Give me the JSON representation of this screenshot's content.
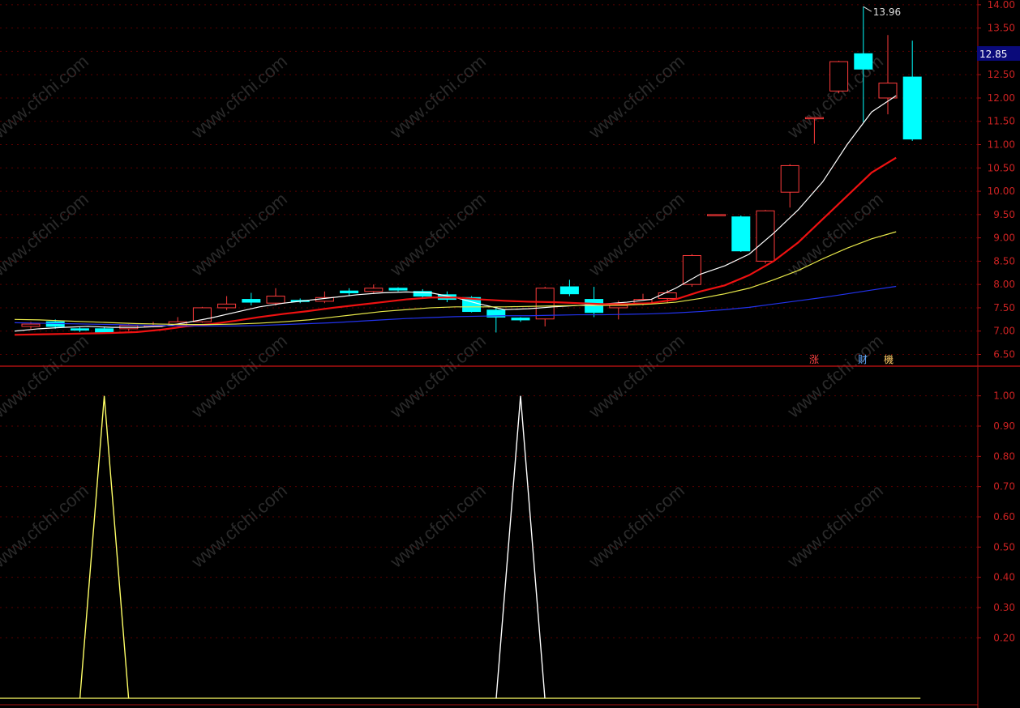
{
  "chart_data": [
    {
      "type": "candlestick",
      "price_axis": {
        "ylim": [
          6.3,
          14.05
        ],
        "ticks": [
          14.0,
          13.5,
          13.0,
          12.5,
          12.0,
          11.5,
          11.0,
          10.5,
          10.0,
          9.5,
          9.0,
          8.5,
          8.0,
          7.5,
          7.0,
          6.5
        ]
      },
      "last_price": "12.85",
      "max_label": "13.96",
      "candles": [
        {
          "o": 7.1,
          "c": 7.15,
          "h": 7.2,
          "l": 7.05
        },
        {
          "o": 7.2,
          "c": 7.1,
          "h": 7.25,
          "l": 7.05
        },
        {
          "o": 7.05,
          "c": 7.02,
          "h": 7.08,
          "l": 6.98
        },
        {
          "o": 7.05,
          "c": 6.98,
          "h": 7.08,
          "l": 6.95
        },
        {
          "o": 7.05,
          "c": 7.12,
          "h": 7.15,
          "l": 7.0
        },
        {
          "o": 7.1,
          "c": 7.12,
          "h": 7.2,
          "l": 7.08
        },
        {
          "o": 7.12,
          "c": 7.2,
          "h": 7.3,
          "l": 7.1
        },
        {
          "o": 7.2,
          "c": 7.5,
          "h": 7.52,
          "l": 7.18
        },
        {
          "o": 7.5,
          "c": 7.58,
          "h": 7.75,
          "l": 7.45
        },
        {
          "o": 7.68,
          "c": 7.62,
          "h": 7.82,
          "l": 7.55
        },
        {
          "o": 7.6,
          "c": 7.75,
          "h": 7.92,
          "l": 7.55
        },
        {
          "o": 7.66,
          "c": 7.64,
          "h": 7.7,
          "l": 7.6
        },
        {
          "o": 7.64,
          "c": 7.72,
          "h": 7.85,
          "l": 7.6
        },
        {
          "o": 7.86,
          "c": 7.82,
          "h": 7.92,
          "l": 7.75
        },
        {
          "o": 7.85,
          "c": 7.92,
          "h": 8.0,
          "l": 7.8
        },
        {
          "o": 7.92,
          "c": 7.88,
          "h": 7.94,
          "l": 7.85
        },
        {
          "o": 7.85,
          "c": 7.75,
          "h": 7.9,
          "l": 7.72
        },
        {
          "o": 7.78,
          "c": 7.68,
          "h": 7.85,
          "l": 7.62
        },
        {
          "o": 7.72,
          "c": 7.42,
          "h": 7.75,
          "l": 7.4
        },
        {
          "o": 7.45,
          "c": 7.3,
          "h": 7.52,
          "l": 6.97
        },
        {
          "o": 7.28,
          "c": 7.24,
          "h": 7.3,
          "l": 7.2
        },
        {
          "o": 7.26,
          "c": 7.92,
          "h": 7.95,
          "l": 7.1
        },
        {
          "o": 7.95,
          "c": 7.8,
          "h": 8.1,
          "l": 7.75
        },
        {
          "o": 7.68,
          "c": 7.4,
          "h": 7.95,
          "l": 7.3
        },
        {
          "o": 7.5,
          "c": 7.55,
          "h": 7.65,
          "l": 7.25
        },
        {
          "o": 7.6,
          "c": 7.68,
          "h": 7.8,
          "l": 7.55
        },
        {
          "o": 7.7,
          "c": 7.82,
          "h": 7.88,
          "l": 7.6
        },
        {
          "o": 8.0,
          "c": 8.62,
          "h": 8.65,
          "l": 7.95
        },
        {
          "o": 9.5,
          "c": 9.5,
          "h": 9.5,
          "l": 9.5
        },
        {
          "o": 9.45,
          "c": 8.72,
          "h": 9.48,
          "l": 8.7
        },
        {
          "o": 8.5,
          "c": 9.58,
          "h": 9.6,
          "l": 8.45
        },
        {
          "o": 9.98,
          "c": 10.55,
          "h": 10.58,
          "l": 9.65
        },
        {
          "o": 11.58,
          "c": 11.58,
          "h": 11.58,
          "l": 11.02
        },
        {
          "o": 12.15,
          "c": 12.78,
          "h": 12.8,
          "l": 12.1
        },
        {
          "o": 12.95,
          "c": 12.62,
          "h": 13.96,
          "l": 11.48
        },
        {
          "o": 12.0,
          "c": 12.32,
          "h": 13.35,
          "l": 11.65
        },
        {
          "o": 12.45,
          "c": 11.12,
          "h": 13.23,
          "l": 11.08
        }
      ],
      "series": [
        {
          "name": "MA5",
          "color": "#ffffff",
          "values": [
            7.0,
            7.05,
            7.08,
            7.1,
            7.08,
            7.08,
            7.1,
            7.18,
            7.28,
            7.4,
            7.52,
            7.6,
            7.66,
            7.72,
            7.78,
            7.82,
            7.84,
            7.82,
            7.72,
            7.58,
            7.46,
            7.48,
            7.52,
            7.55,
            7.58,
            7.62,
            7.68,
            7.92,
            8.22,
            8.4,
            8.65,
            9.1,
            9.6,
            10.2,
            11.0,
            11.7,
            12.05
          ]
        },
        {
          "name": "MA10",
          "color": "#ee1111",
          "values": [
            6.92,
            6.93,
            6.94,
            6.95,
            6.96,
            6.98,
            7.03,
            7.1,
            7.15,
            7.22,
            7.3,
            7.37,
            7.43,
            7.5,
            7.56,
            7.62,
            7.68,
            7.72,
            7.72,
            7.68,
            7.65,
            7.63,
            7.62,
            7.6,
            7.58,
            7.58,
            7.6,
            7.68,
            7.85,
            7.98,
            8.2,
            8.5,
            8.9,
            9.4,
            9.9,
            10.4,
            10.72
          ]
        },
        {
          "name": "MA20",
          "color": "#e8e84a",
          "values": [
            7.25,
            7.24,
            7.22,
            7.2,
            7.18,
            7.16,
            7.15,
            7.14,
            7.14,
            7.15,
            7.17,
            7.2,
            7.24,
            7.3,
            7.36,
            7.42,
            7.46,
            7.5,
            7.52,
            7.52,
            7.52,
            7.53,
            7.54,
            7.55,
            7.55,
            7.56,
            7.58,
            7.62,
            7.7,
            7.8,
            7.92,
            8.1,
            8.3,
            8.55,
            8.78,
            8.98,
            9.13
          ]
        },
        {
          "name": "MA60",
          "color": "#2233ee",
          "values": [
            7.18,
            7.17,
            7.16,
            7.15,
            7.14,
            7.13,
            7.12,
            7.11,
            7.11,
            7.11,
            7.12,
            7.14,
            7.16,
            7.18,
            7.21,
            7.24,
            7.27,
            7.29,
            7.31,
            7.32,
            7.33,
            7.33,
            7.34,
            7.35,
            7.35,
            7.36,
            7.37,
            7.39,
            7.42,
            7.46,
            7.51,
            7.58,
            7.65,
            7.72,
            7.8,
            7.88,
            7.96
          ]
        }
      ],
      "tags": [
        {
          "text": "涨",
          "color": "#ff4444"
        },
        {
          "text": "财",
          "color": "#66aaff"
        },
        {
          "text": "機",
          "color": "#ffcc66"
        }
      ]
    },
    {
      "type": "line",
      "ylim": [
        0,
        1.05
      ],
      "ticks": [
        1.0,
        0.9,
        0.8,
        0.7,
        0.6,
        0.5,
        0.4,
        0.3,
        0.2
      ],
      "series": [
        {
          "color": "#ffff66",
          "values": [
            0,
            0,
            0,
            1,
            0,
            0,
            0,
            0,
            0,
            0,
            0,
            0,
            0,
            0,
            0,
            0,
            0,
            0,
            0,
            0,
            0,
            0,
            0,
            0,
            0,
            0,
            0,
            0,
            0,
            0,
            0,
            0,
            0,
            0,
            0,
            0,
            0
          ]
        },
        {
          "color": "#ffffff",
          "values": [
            0,
            0,
            0,
            0,
            0,
            0,
            0,
            0,
            0,
            0,
            0,
            0,
            0,
            0,
            0,
            0,
            0,
            0,
            0,
            0,
            1,
            0,
            0,
            0,
            0,
            0,
            0,
            0,
            0,
            0,
            0,
            0,
            0,
            0,
            0,
            0,
            0
          ]
        }
      ]
    }
  ],
  "watermark": "www.cfchi.com"
}
